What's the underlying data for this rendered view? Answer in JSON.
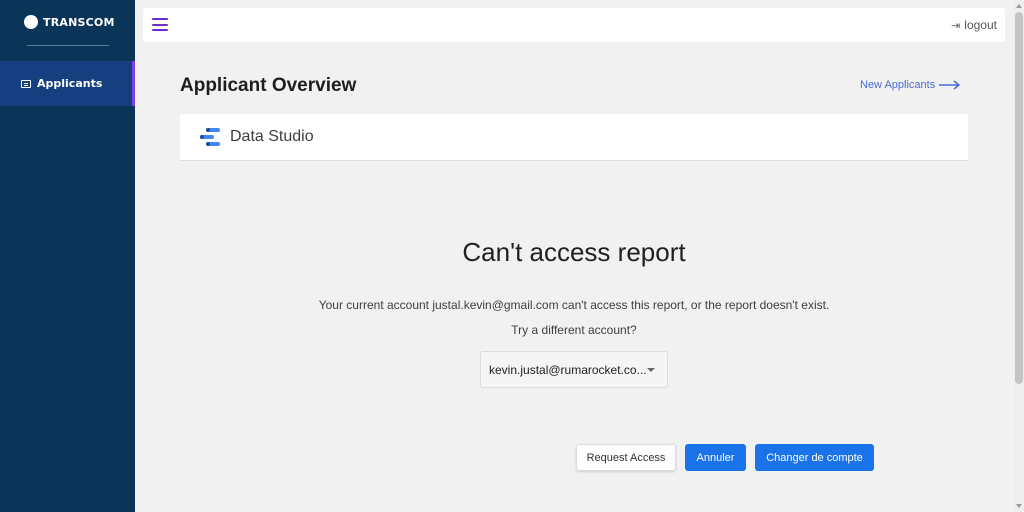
{
  "sidebar": {
    "brand": "TRANSCOM",
    "items": [
      {
        "label": "Applicants",
        "icon": "id-card-icon",
        "active": true
      }
    ]
  },
  "topbar": {
    "logout_label": "logout"
  },
  "main": {
    "title": "Applicant Overview",
    "new_applicants_label": "New Applicants"
  },
  "report": {
    "app_name": "Data Studio",
    "error_title": "Can't access report",
    "error_message": "Your current account justal.kevin@gmail.com can't access this report, or the report doesn't exist.",
    "try_prompt": "Try a different account?",
    "selected_account": "kevin.justal@rumarocket.co...",
    "buttons": {
      "request": "Request Access",
      "cancel": "Annuler",
      "change": "Changer de compte"
    }
  },
  "colors": {
    "sidebar_bg": "#0b3558",
    "active_item_bg": "#163f80",
    "accent_purple": "#6f2bd6",
    "link_blue": "#4a6cd6",
    "button_blue": "#1a73e8"
  }
}
